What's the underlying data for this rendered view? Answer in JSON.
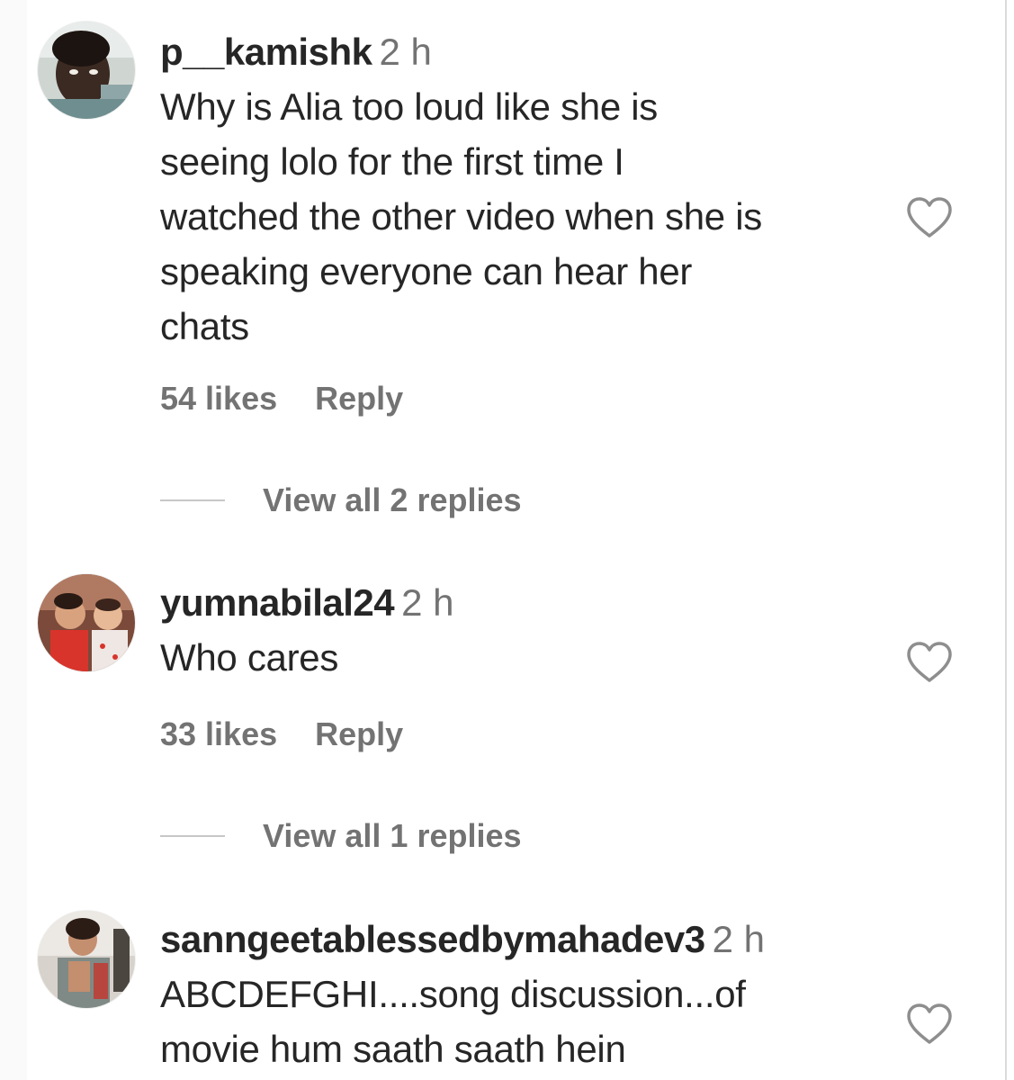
{
  "comments": [
    {
      "username": "p__kamishk",
      "time": "2 h",
      "lines": [
        "Why is Alia too loud like she is",
        "seeing lolo for the first time I",
        "watched the other video when she is",
        "speaking everyone can hear her",
        "chats"
      ],
      "likes": "54 likes",
      "reply": "Reply",
      "view_replies": "View all 2 replies"
    },
    {
      "username": "yumnabilal24",
      "time": "2 h",
      "lines": [
        "Who cares"
      ],
      "likes": "33 likes",
      "reply": "Reply",
      "view_replies": "View all 1 replies"
    },
    {
      "username": "sanngeetablessedbymahadev3",
      "time": "2 h",
      "lines": [
        "ABCDEFGHI....song discussion...of",
        "movie hum saath saath hein"
      ]
    }
  ],
  "icons": {
    "heart": "heart-outline-icon",
    "avatar": "user-avatar"
  },
  "colors": {
    "text": "#262626",
    "secondary": "#737373",
    "divider": "#c7c7c7"
  }
}
